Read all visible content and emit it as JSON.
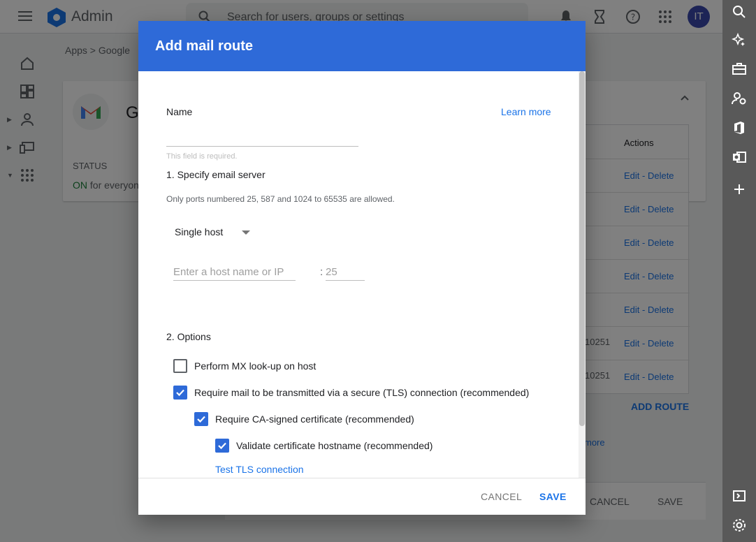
{
  "topbar": {
    "app_title": "Admin",
    "search_placeholder": "Search for users, groups or settings",
    "avatar_initials": "IT"
  },
  "background": {
    "breadcrumb": "Apps  >  Google",
    "card_title": "Gi",
    "status_label": "STATUS",
    "status_on": "ON",
    "status_rest": " for everyone",
    "table_actions_header": "Actions",
    "rows": [
      {
        "value": "",
        "actions": "Edit - Delete"
      },
      {
        "value": "",
        "actions": "Edit - Delete"
      },
      {
        "value": "",
        "actions": "Edit - Delete"
      },
      {
        "value": "",
        "actions": "Edit - Delete"
      },
      {
        "value": "",
        "actions": "Edit - Delete"
      },
      {
        "value": "10251",
        "actions": "Edit - Delete"
      },
      {
        "value": "10251",
        "actions": "Edit - Delete"
      }
    ],
    "add_route": "ADD ROUTE",
    "learn_more": "more",
    "cancel": "CANCEL",
    "save": "SAVE"
  },
  "dialog": {
    "title": "Add mail route",
    "name_label": "Name",
    "learn_more": "Learn more",
    "name_value": "",
    "required_msg": "This field is required.",
    "section1_title": "1. Specify email server",
    "ports_note": "Only ports numbered 25, 587 and 1024 to 65535 are allowed.",
    "host_mode": "Single host",
    "host_placeholder": "Enter a host name or IP",
    "port_separator": ":",
    "port_placeholder": "25",
    "section2_title": "2. Options",
    "options": [
      {
        "label": "Perform MX look-up on host",
        "checked": false
      },
      {
        "label": "Require mail to be transmitted via a secure (TLS) connection (recommended)",
        "checked": true
      },
      {
        "label": "Require CA-signed certificate (recommended)",
        "checked": true
      },
      {
        "label": "Validate certificate hostname (recommended)",
        "checked": true
      }
    ],
    "test_tls": "Test TLS connection",
    "cancel_label": "CANCEL",
    "save_label": "SAVE"
  },
  "colors": {
    "header_blue": "#2e6ad8",
    "link_blue": "#1a73e8",
    "status_green": "#188038"
  }
}
